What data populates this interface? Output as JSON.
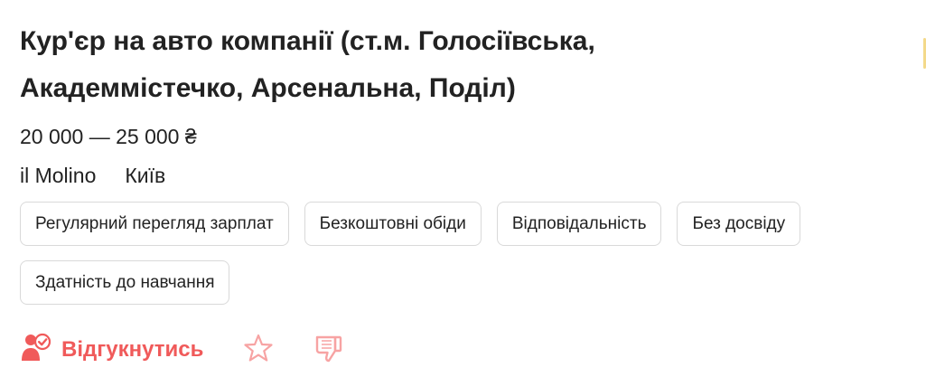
{
  "job": {
    "title": "Кур'єр на авто компанії (ст.м. Голосіївська, Академмістечко, Арсенальна, Поділ)",
    "salary": "20 000 — 25 000 ₴",
    "company": "il Molino",
    "city": "Київ"
  },
  "tags": [
    {
      "label": "Регулярний перегляд зарплат"
    },
    {
      "label": "Безкоштовні обіди"
    },
    {
      "label": "Відповідальність"
    },
    {
      "label": "Без досвіду"
    },
    {
      "label": "Здатність до навчання"
    }
  ],
  "actions": {
    "respond_label": "Відгукнутись",
    "respond_icon": "person-check-icon",
    "favorite_icon": "star-icon",
    "dislike_icon": "thumbs-down-icon"
  },
  "colors": {
    "accent": "#f05a5a",
    "accent_light": "#f7a3a3",
    "text": "#222222",
    "tag_border": "#d9d9d9"
  }
}
